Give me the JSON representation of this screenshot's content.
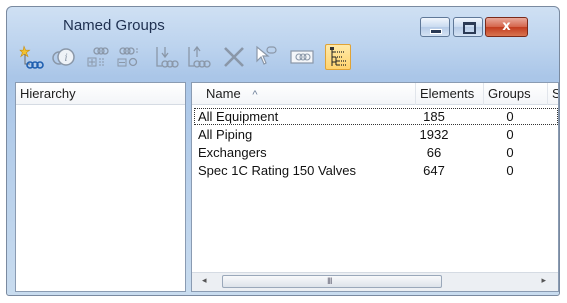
{
  "window": {
    "title": "Named Groups",
    "close_glyph": "x"
  },
  "toolbar": {
    "buttons": [
      {
        "icon": "new-group-icon",
        "active": false
      },
      {
        "icon": "group-info-icon",
        "active": false
      },
      {
        "icon": "add-elements-icon",
        "active": false
      },
      {
        "icon": "subgroup-icon",
        "active": false
      },
      {
        "icon": "import-icon",
        "active": false
      },
      {
        "icon": "export-icon",
        "active": false
      },
      {
        "icon": "delete-icon",
        "active": false
      },
      {
        "icon": "pick-icon",
        "active": false
      },
      {
        "icon": "rename-icon",
        "active": false
      },
      {
        "icon": "hierarchy-view-icon",
        "active": true
      }
    ]
  },
  "left_panel": {
    "header": "Hierarchy"
  },
  "list": {
    "columns": {
      "name": "Name",
      "sort_glyph": "^",
      "elements": "Elements",
      "groups": "Groups",
      "extra": "S"
    },
    "rows": [
      {
        "name": "All Equipment",
        "elements": "185",
        "groups": "0",
        "selected": true
      },
      {
        "name": "All Piping",
        "elements": "1932",
        "groups": "0",
        "selected": false
      },
      {
        "name": "Exchangers",
        "elements": "66",
        "groups": "0",
        "selected": false
      },
      {
        "name": "Spec 1C Rating 150 Valves",
        "elements": "647",
        "groups": "0",
        "selected": false
      }
    ],
    "scroll": {
      "left_arrow": "◂",
      "right_arrow": "▸",
      "grip": "III"
    }
  }
}
